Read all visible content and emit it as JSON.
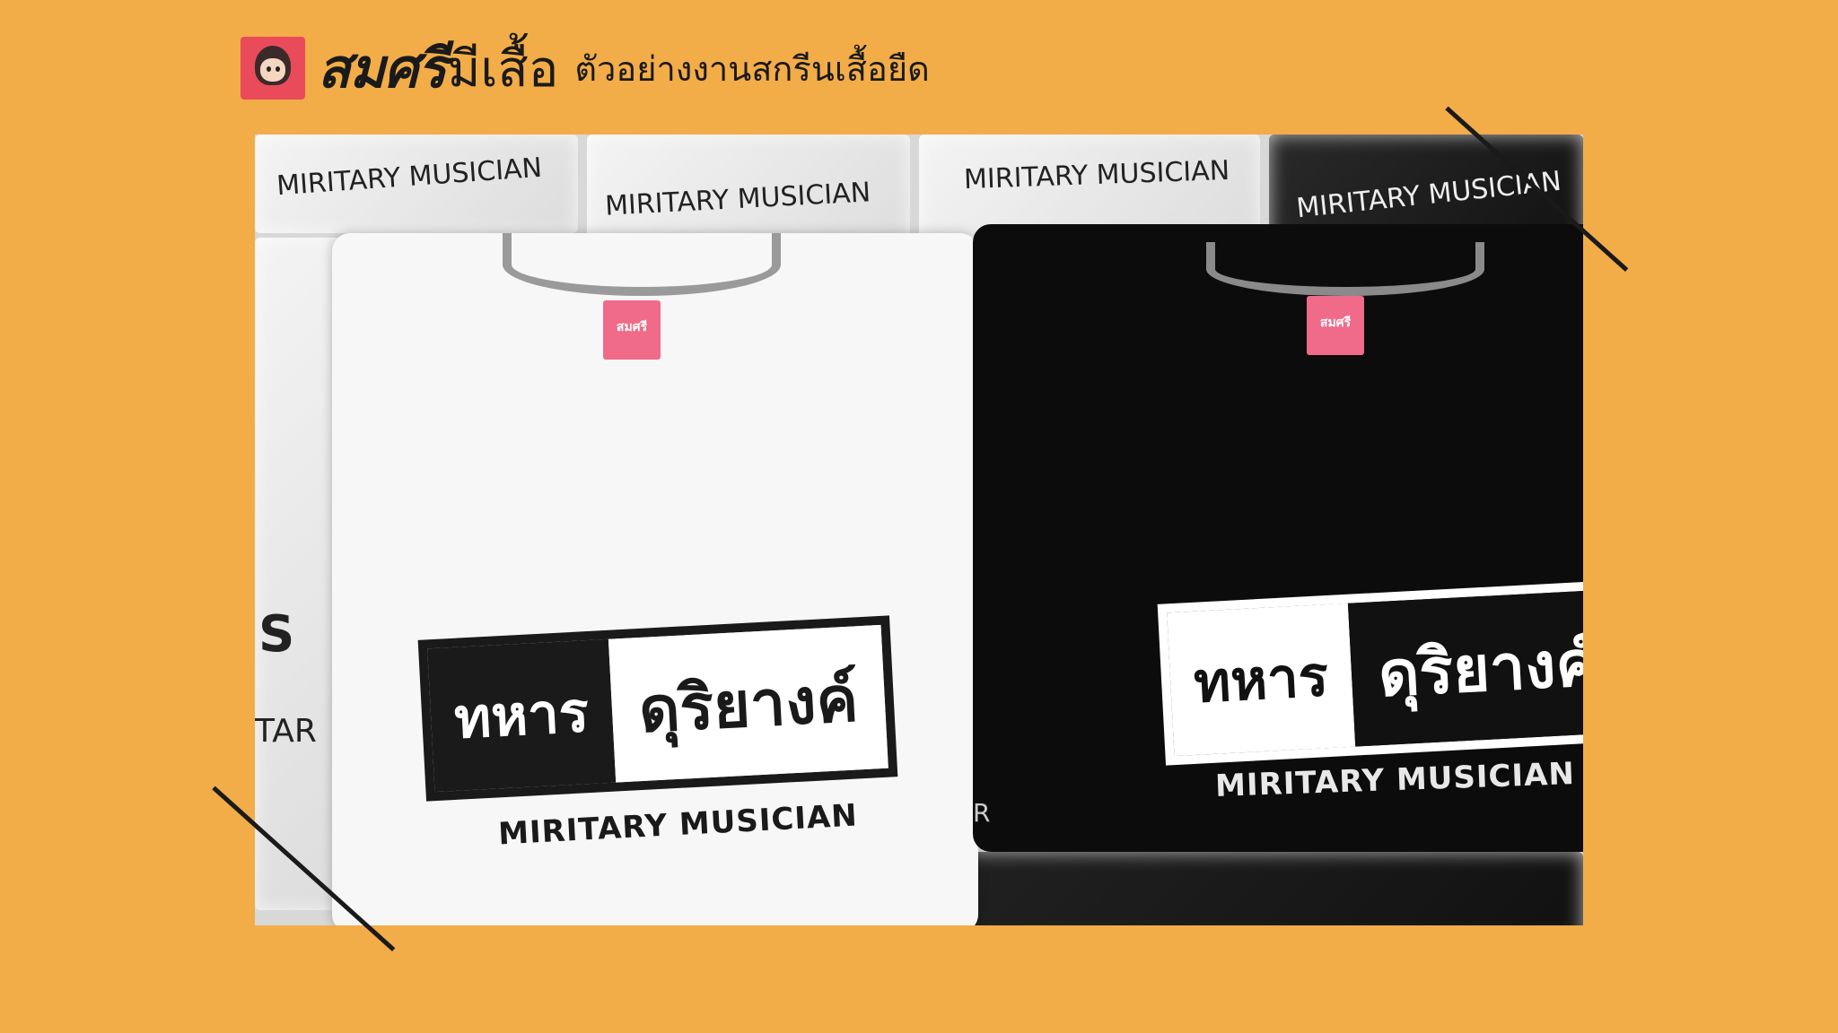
{
  "header": {
    "brand_bold": "สมศรี",
    "brand_regular": "มีเสื้อ",
    "subtitle": "ตัวอย่างงานสกรีนเสื้อยืด",
    "logo_tag": "สมศรี"
  },
  "photo": {
    "top_bags": [
      {
        "label": "MIRITARY MUSICIAN",
        "tone": "white"
      },
      {
        "label": "MIRITARY MUSICIAN",
        "tone": "white"
      },
      {
        "label": "MIRITARY MUSICIAN",
        "tone": "white"
      },
      {
        "label": "MIRITARY MUSICIAN",
        "tone": "dark"
      }
    ],
    "white_shirt": {
      "neck_tag": "สมศรี",
      "print_left": "ทหาร",
      "print_right": "ดุริยางค์",
      "sub_print": "MIRITARY MUSICIAN"
    },
    "black_shirt": {
      "neck_tag": "สมศรี",
      "print_left": "ทหาร",
      "print_right": "ดุริยางค์",
      "sub_print": "MIRITARY MUSICIAN"
    },
    "side_fragments": [
      "S",
      "TAR",
      "R"
    ]
  },
  "colors": {
    "background": "#F2AC48",
    "tag_pink": "#F06A8A"
  }
}
